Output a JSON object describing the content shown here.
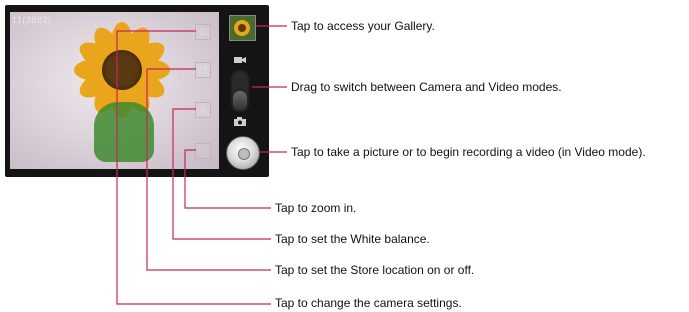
{
  "camera": {
    "counter_text": "11(2882)"
  },
  "callouts": {
    "gallery": "Tap to access your Gallery.",
    "mode_switch": "Drag to switch between Camera and Video modes.",
    "shutter": "Tap to take a picture or to begin recording a video (in Video mode).",
    "zoom": "Tap to zoom in.",
    "white_balance": "Tap to set the White balance.",
    "store_location": "Tap to set the Store location on or off.",
    "settings": "Tap to change the camera settings."
  },
  "colors": {
    "callout_line": "#c4285a",
    "panel": "#141414",
    "flower_petal": "#e9a51c"
  },
  "icons": {
    "video": "video-camera-icon",
    "photo": "camera-icon",
    "settings": "gear-icon",
    "location": "location-icon",
    "white_balance": "white-balance-icon",
    "zoom": "zoom-icon"
  }
}
